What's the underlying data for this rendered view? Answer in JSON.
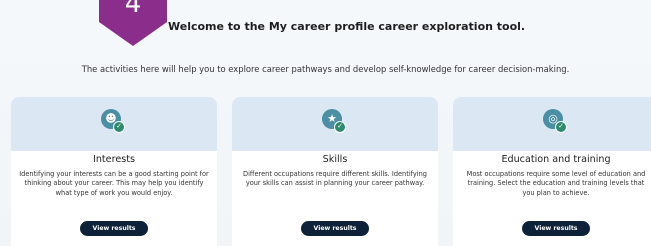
{
  "step": {
    "number": "4"
  },
  "header": {
    "title": "Welcome to the My career profile career exploration tool.",
    "subtitle": "The activities here will help you to explore career pathways and develop self-knowledge for career decision-making."
  },
  "cards": [
    {
      "title": "Interests",
      "description": "Identifying your interests can be a good starting point for thinking about your career. This may help you identify what type of work you would enjoy.",
      "button_label": "View results",
      "icon": "interests-icon"
    },
    {
      "title": "Skills",
      "description": "Different occupations require different skills. Identifying your skills can assist in planning your career pathway.",
      "button_label": "View results",
      "icon": "skills-icon"
    },
    {
      "title": "Education and training",
      "description": "Most occupations require some level of education and training. Select the education and training levels that you plan to achieve.",
      "button_label": "View results",
      "icon": "education-icon"
    }
  ],
  "colors": {
    "badge": "#8b2d8a",
    "card_header": "#dbe8f3",
    "button": "#0d2238",
    "icon": "#4a8fa3",
    "check": "#2e8b6e"
  }
}
